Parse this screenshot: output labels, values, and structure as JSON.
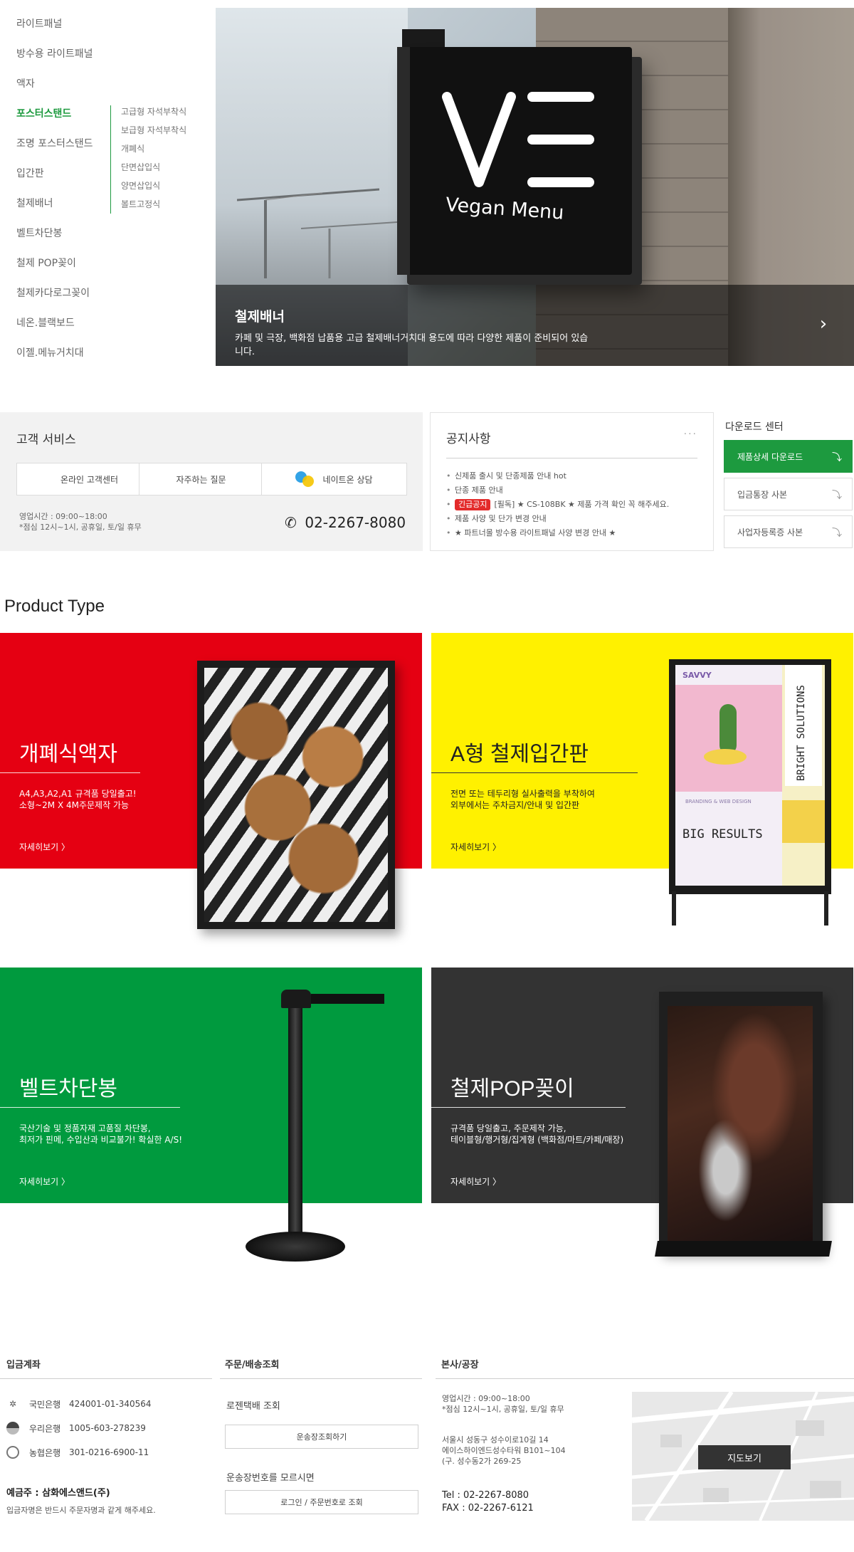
{
  "category_nav": {
    "items": [
      {
        "label": "라이트패널"
      },
      {
        "label": "방수용 라이트패널"
      },
      {
        "label": "액자"
      },
      {
        "label": "포스터스탠드",
        "active": true
      },
      {
        "label": "조명 포스터스탠드"
      },
      {
        "label": "입간판"
      },
      {
        "label": "철제배너"
      },
      {
        "label": "벨트차단봉"
      },
      {
        "label": "철제 POP꽂이"
      },
      {
        "label": "철제카다로그꽂이"
      },
      {
        "label": "네온.블랙보드"
      },
      {
        "label": "이젤.메뉴거치대"
      }
    ],
    "subitems": [
      {
        "label": "고급형 자석부착식"
      },
      {
        "label": "보급형 자석부착식"
      },
      {
        "label": "개폐식"
      },
      {
        "label": "단면삽입식"
      },
      {
        "label": "양면삽입식"
      },
      {
        "label": "볼트고정식"
      }
    ],
    "accent": "#1d9a3f"
  },
  "hero": {
    "title": "철제배너",
    "description": "카페 및 극장, 백화점 납품용 고급 철제배너거치대 용도에 따라 다양한 제품이 준비되어 있습니다.",
    "sign_text": "Vegan Menu",
    "next_icon": "chevron-right-icon"
  },
  "customer_service": {
    "title": "고객 서비스",
    "buttons": [
      {
        "label": "온라인 고객센터"
      },
      {
        "label": "자주하는 질문"
      },
      {
        "label": "네이트온 상담"
      }
    ],
    "hours_line1": "영업시간 : 09:00~18:00",
    "hours_line2": "*점심 12시~1시, 공휴일, 토/일 휴무",
    "phone": "02-2267-8080"
  },
  "notice": {
    "title": "공지사항",
    "more": "···",
    "items": [
      {
        "text": "신제품 출시 및 단종제품 안내 hot"
      },
      {
        "text": "단종 제품 안내"
      },
      {
        "badge": "긴급공지",
        "text": "[필독] ★ CS-108BK ★ 제품 가격 확인 꼭 해주세요."
      },
      {
        "text": "제품 사양 및 단가 변경 안내"
      },
      {
        "text": "★ 파트너몰 방수용 라이트패널 사양 변경 안내 ★"
      }
    ]
  },
  "download": {
    "title": "다운로드 센터",
    "buttons": [
      {
        "label": "제품상세 다운로드"
      },
      {
        "label": "입금통장 사본"
      },
      {
        "label": "사업자등록증 사본"
      }
    ]
  },
  "product_type": {
    "title": "Product Type",
    "cards": [
      {
        "title": "개폐식액자",
        "desc1": "A4,A3,A2,A1 규격품 당일출고!",
        "desc2": "소형~2M X 4M주문제작 가능",
        "more": "자세히보기 〉",
        "color": "#e50012"
      },
      {
        "title": "A형 철제입간판",
        "desc1": "전면 또는 테두리형 실사출력을 부착하여",
        "desc2": "외부에서는 주차금지/안내 및 입간판",
        "more": "자세히보기 〉",
        "color": "#fff100"
      },
      {
        "title": "벨트차단봉",
        "desc1": "국산기술 및 정품자재 고품질 차단봉,",
        "desc2": "최저가 핀메, 수입산과 비교불가! 확실한 A/S!",
        "more": "자세히보기 〉",
        "color": "#009a3e"
      },
      {
        "title": "철제POP꽂이",
        "desc1": "규격품 당일출고, 주문제작 가능,",
        "desc2": "테이블형/행거형/집게형 (백화점/마트/카페/매장)",
        "more": "자세히보기 〉",
        "color": "#333333"
      }
    ],
    "poster": {
      "brand": "SAVVY",
      "side": "BRIGHT SOLUTIONS",
      "big": "BIG RESULTS",
      "small": "BRANDING & WEB DESIGN"
    }
  },
  "footer": {
    "account": {
      "title": "입금계좌",
      "banks": [
        {
          "name": "국민은행",
          "number": "424001-01-340564"
        },
        {
          "name": "우리은행",
          "number": "1005-603-278239"
        },
        {
          "name": "농협은행",
          "number": "301-0216-6900-11"
        }
      ],
      "holder": "예금주 : 삼화에스앤드(주)",
      "note": "입금자명은 반드시 주문자명과 같게 해주세요."
    },
    "delivery": {
      "title": "주문/배송조회",
      "carrier": "로젠택배 조회",
      "track_button": "운송장조회하기",
      "unknown": "운송장번호를 모르시면",
      "login_button": "로그인 / 주문번호로 조회"
    },
    "office": {
      "title": "본사/공장",
      "hours_line1": "영업시간 : 09:00~18:00",
      "hours_line2": "*점심 12시~1시, 공휴일, 토/일 휴무",
      "addr_line1": "서울시 성동구 성수이로10길 14",
      "addr_line2": "에이스하이엔드성수타워 B101~104",
      "addr_line3": "(구. 성수동2가 269-25",
      "tel": "Tel : 02-2267-8080",
      "fax": "FAX : 02-2267-6121",
      "map_button": "지도보기"
    }
  }
}
